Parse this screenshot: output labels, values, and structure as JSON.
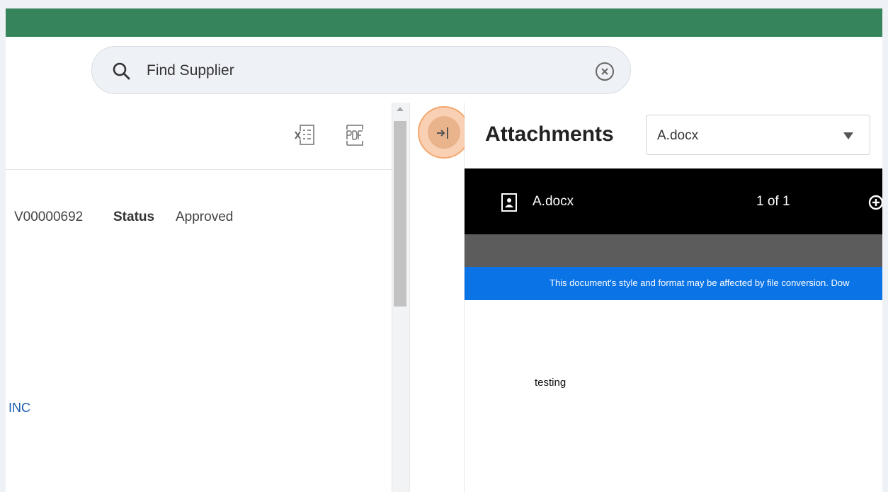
{
  "search": {
    "text": "Find Supplier"
  },
  "toolbar": {
    "excel_icon": "excel-export-icon",
    "pdf_icon": "pdf-export-icon"
  },
  "record": {
    "id": "V00000692",
    "status_label": "Status",
    "status_value": "Approved",
    "link": "INC"
  },
  "attachments": {
    "title": "Attachments",
    "selected_file": "A.docx",
    "viewer_file": "A.docx",
    "page_indicator": "1 of 1",
    "notice": "This document's style and format may be affected by file conversion. Dow",
    "content": "testing"
  },
  "colors": {
    "topbar": "#35845c",
    "link": "#1a5fa8",
    "notice_band": "#0a73e6",
    "highlight": "#f4a66d"
  }
}
